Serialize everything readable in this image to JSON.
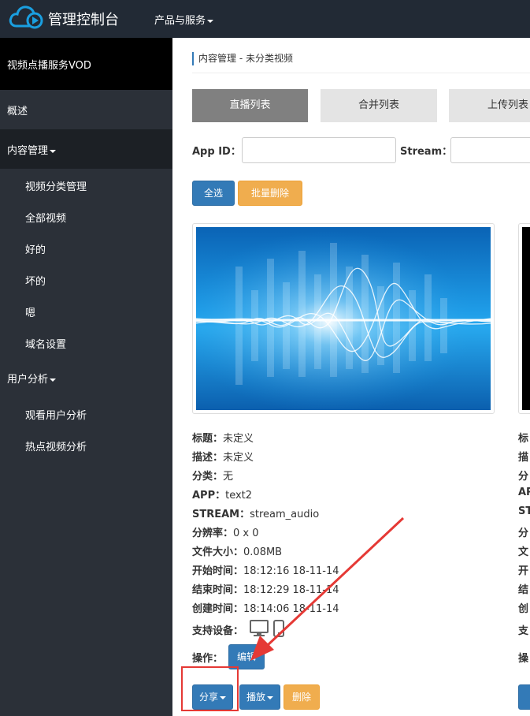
{
  "topbar": {
    "title": "管理控制台",
    "menu": "产品与服务"
  },
  "sidebar": {
    "service": "视频点播服务VOD",
    "overview": "概述",
    "content_mgmt": "内容管理",
    "content_items": [
      "视频分类管理",
      "全部视频",
      "好的",
      "坏的",
      "嗯",
      "域名设置"
    ],
    "user_analysis": "用户分析",
    "analysis_items": [
      "观看用户分析",
      "热点视频分析"
    ]
  },
  "breadcrumb": "内容管理 - 未分类视频",
  "tabs": [
    "直播列表",
    "合并列表",
    "上传列表"
  ],
  "filters": {
    "appid_label": "App ID：",
    "stream_label": "Stream："
  },
  "actions": {
    "select_all": "全选",
    "batch_delete": "批量删除"
  },
  "video": {
    "fields": [
      {
        "label": "标题：",
        "value": "未定义"
      },
      {
        "label": "描述：",
        "value": "未定义"
      },
      {
        "label": "分类：",
        "value": "无"
      },
      {
        "label": "APP：",
        "value": "text2"
      },
      {
        "label": "STREAM：",
        "value": "stream_audio"
      },
      {
        "label": "分辨率：",
        "value": "0 x 0"
      },
      {
        "label": "文件大小：",
        "value": "0.08MB"
      },
      {
        "label": "开始时间：",
        "value": "18:12:16 18-11-14"
      },
      {
        "label": "结束时间：",
        "value": "18:12:29 18-11-14"
      },
      {
        "label": "创建时间：",
        "value": "18:14:06 18-11-14"
      }
    ],
    "devices_label": "支持设备：",
    "ops_label": "操作：",
    "edit": "编辑",
    "share": "分享",
    "play": "播放",
    "delete": "删除"
  },
  "video2_labels": [
    "标",
    "描",
    "分",
    "AP",
    "ST",
    "分",
    "文",
    "开",
    "结",
    "创",
    "支",
    "操"
  ],
  "colors": {
    "topbar": "#222a35",
    "sidebar": "#2b3038",
    "primary": "#337ab7",
    "warning": "#f0ad4e",
    "annotation": "#e53935"
  }
}
